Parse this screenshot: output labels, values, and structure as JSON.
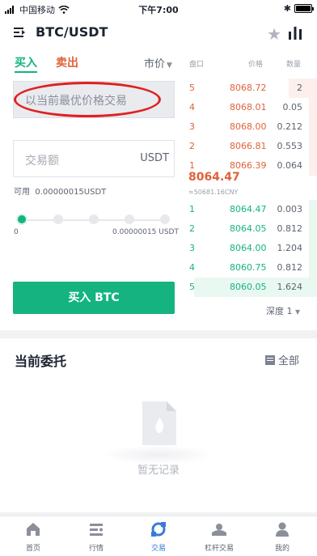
{
  "status_bar": {
    "carrier": "中国移动",
    "time": "下午7:00"
  },
  "header": {
    "pair": "BTC/USDT",
    "favorite_icon": "star-icon",
    "chart_icon": "bar-chart-icon"
  },
  "trade": {
    "tab_buy": "买入",
    "tab_sell": "卖出",
    "order_type": "市价",
    "price_placeholder": "以当前最优价格交易",
    "amount_placeholder": "交易额",
    "amount_unit": "USDT",
    "available_label": "可用",
    "available_value": "0.00000015USDT",
    "slider_min": "0",
    "slider_max": "0.00000015 USDT",
    "slider_level": 0,
    "buy_button": "买入 BTC"
  },
  "orderbook": {
    "headers": {
      "col1": "盘口",
      "col2": "价格",
      "col3": "数量"
    },
    "asks": [
      {
        "idx": "5",
        "price": "8068.72",
        "qty": "2",
        "depth": 0.22
      },
      {
        "idx": "4",
        "price": "8068.01",
        "qty": "0.05",
        "depth": 0.06
      },
      {
        "idx": "3",
        "price": "8068.00",
        "qty": "0.212",
        "depth": 0.06
      },
      {
        "idx": "2",
        "price": "8066.81",
        "qty": "0.553",
        "depth": 0.06
      },
      {
        "idx": "1",
        "price": "8066.39",
        "qty": "0.064",
        "depth": 0.06
      }
    ],
    "last_price": "8064.47",
    "last_price_cny": "≈50681.16CNY",
    "bids": [
      {
        "idx": "1",
        "price": "8064.47",
        "qty": "0.003",
        "depth": 0.06
      },
      {
        "idx": "2",
        "price": "8064.05",
        "qty": "0.812",
        "depth": 0.06
      },
      {
        "idx": "3",
        "price": "8064.00",
        "qty": "1.204",
        "depth": 0.06
      },
      {
        "idx": "4",
        "price": "8060.75",
        "qty": "0.812",
        "depth": 0.06
      },
      {
        "idx": "5",
        "price": "8060.05",
        "qty": "1.624",
        "depth": 0.95
      }
    ],
    "depth_select": "深度 1"
  },
  "orders": {
    "title": "当前委托",
    "all_label": "全部",
    "empty_text": "暂无记录"
  },
  "tabbar": [
    {
      "label": "首页",
      "icon": "home-icon"
    },
    {
      "label": "行情",
      "icon": "market-icon"
    },
    {
      "label": "交易",
      "icon": "trade-icon",
      "active": true
    },
    {
      "label": "杠杆交易",
      "icon": "margin-icon"
    },
    {
      "label": "我的",
      "icon": "profile-icon"
    }
  ],
  "colors": {
    "buy": "#15b37f",
    "sell": "#e06238",
    "annotation": "#e02020",
    "active_tab": "#3a7bd5"
  }
}
